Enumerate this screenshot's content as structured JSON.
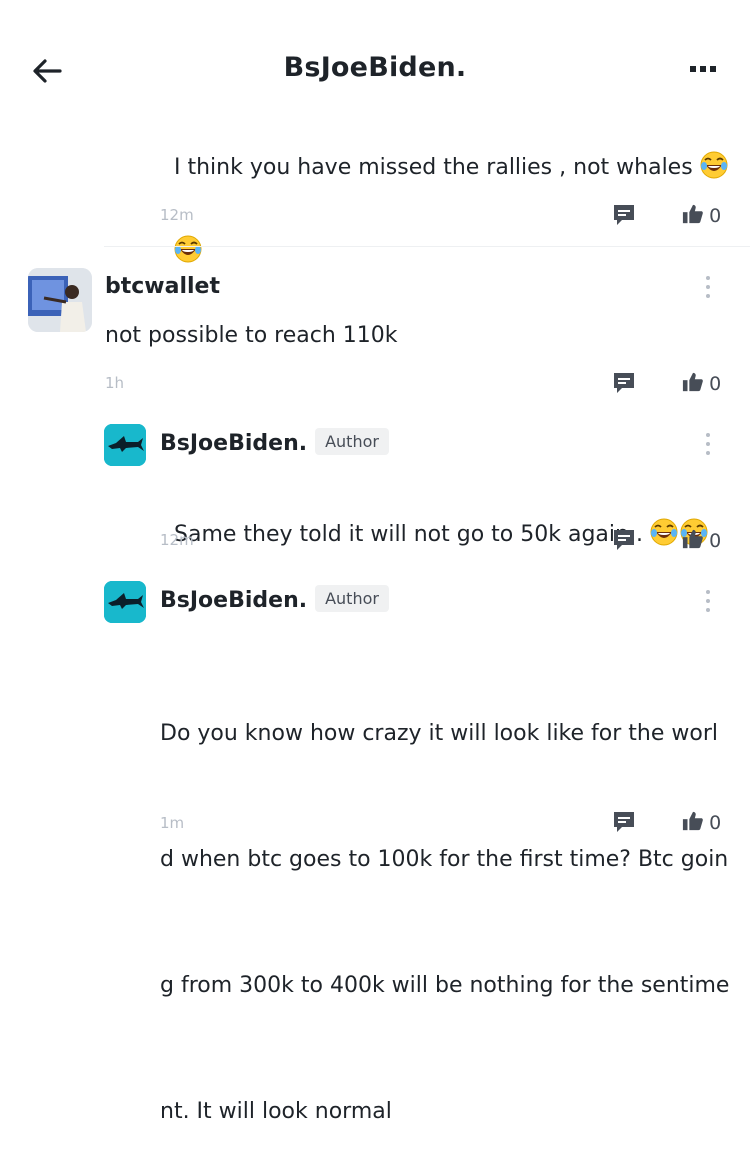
{
  "header": {
    "title": "BsJoeBiden."
  },
  "comments": [
    {
      "body": "I think you have missed the rallies , not whales",
      "time": "12m",
      "likes": "0"
    },
    {
      "username": "btcwallet",
      "body": "not possible to reach 110k",
      "time": "1h",
      "likes": "0"
    },
    {
      "username": "BsJoeBiden.",
      "badge": "Author",
      "body": "Same they told it will not go to 50k again .",
      "time": "12m",
      "likes": "0"
    },
    {
      "username": "BsJoeBiden.",
      "badge": "Author",
      "body_lines": [
        "Do you know how crazy it will look like for the worl",
        "d when btc goes to 100k for the first time? Btc goin",
        "g from 300k to 400k will be nothing for the sentime",
        "nt. It will look normal"
      ],
      "time": "1m",
      "likes": "0"
    }
  ],
  "icons": {
    "back": "arrow-left-icon",
    "more": "more-horizontal-icon",
    "comment": "comment-icon",
    "like": "thumbs-up-icon",
    "kebab": "more-vertical-icon",
    "emoji": "laughing-tears-emoji"
  }
}
